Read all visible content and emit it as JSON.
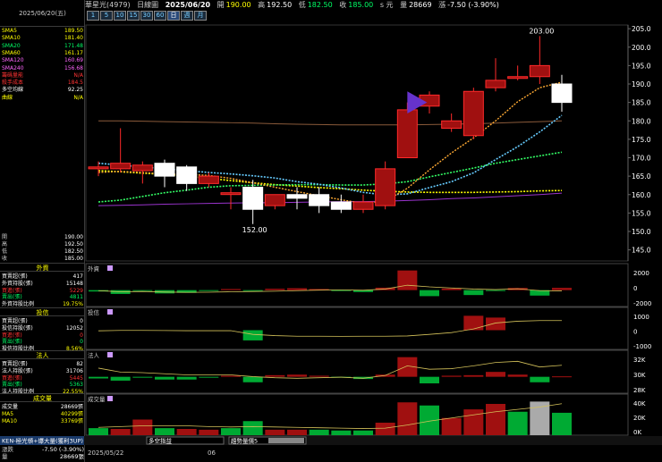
{
  "left": {
    "date": "2025/06/20(五)",
    "ma": [
      {
        "k": "SMA5",
        "v": "189.50",
        "c": "#ffff00"
      },
      {
        "k": "SMA10",
        "v": "181.40",
        "c": "#ffff00"
      },
      {
        "k": "SMA20",
        "v": "171.48",
        "c": "#00ff66"
      },
      {
        "k": "SMA60",
        "v": "161.17",
        "c": "#ffff00"
      },
      {
        "k": "SMA120",
        "v": "160.69",
        "c": "#ff66ff"
      },
      {
        "k": "SMA240",
        "v": "156.68",
        "c": "#ff66ff"
      },
      {
        "k": "籌碼量能",
        "v": "N/A",
        "c": "#ff3333"
      },
      {
        "k": "殺手成本",
        "v": "184.5",
        "c": "#ff3333"
      },
      {
        "k": "多空均線",
        "v": "92.25",
        "c": "#ffffff"
      },
      {
        "k": "曲線",
        "v": "N/A",
        "c": "#ffff00"
      }
    ],
    "ohlc": [
      {
        "k": "開",
        "v": "190.00"
      },
      {
        "k": "高",
        "v": "192.50"
      },
      {
        "k": "低",
        "v": "182.50"
      },
      {
        "k": "收",
        "v": "185.00"
      }
    ],
    "sections": [
      {
        "title": "外資",
        "top": 294,
        "rows": [
          {
            "k": "買賣超(張)",
            "v": "417",
            "kc": "#fff",
            "vc": "#fff"
          },
          {
            "k": "外資持股(張)",
            "v": "15148",
            "kc": "#fff",
            "vc": "#fff"
          },
          {
            "k": "買進(張)",
            "v": "5229",
            "kc": "#ff3333",
            "vc": "#ff3333"
          },
          {
            "k": "賣出(張)",
            "v": "4811",
            "kc": "#00ff66",
            "vc": "#00ff66"
          },
          {
            "k": "外資持股比例",
            "v": "19.75%",
            "kc": "#fff",
            "vc": "#ffff00"
          }
        ]
      },
      {
        "title": "投信",
        "top": 344,
        "rows": [
          {
            "k": "買賣超(張)",
            "v": "0",
            "kc": "#fff",
            "vc": "#fff"
          },
          {
            "k": "投信持股(張)",
            "v": "12052",
            "kc": "#fff",
            "vc": "#fff"
          },
          {
            "k": "買進(張)",
            "v": "0",
            "kc": "#ff3333",
            "vc": "#ff3333"
          },
          {
            "k": "賣出(張)",
            "v": "0",
            "kc": "#00ff66",
            "vc": "#00ff66"
          },
          {
            "k": "投信持股比例",
            "v": "8.56%",
            "kc": "#fff",
            "vc": "#ffff00"
          }
        ]
      },
      {
        "title": "法人",
        "top": 392,
        "rows": [
          {
            "k": "買賣超(張)",
            "v": "82",
            "kc": "#fff",
            "vc": "#fff"
          },
          {
            "k": "法人持股(張)",
            "v": "31706",
            "kc": "#fff",
            "vc": "#fff"
          },
          {
            "k": "買進(張)",
            "v": "5445",
            "kc": "#ff3333",
            "vc": "#ff3333"
          },
          {
            "k": "賣出(張)",
            "v": "5363",
            "kc": "#00ff66",
            "vc": "#00ff66"
          },
          {
            "k": "法人持股比例",
            "v": "22.55%",
            "kc": "#fff",
            "vc": "#ffff00"
          }
        ]
      },
      {
        "title": "成交量",
        "top": 440,
        "rows": [
          {
            "k": "成交量",
            "v": "28669張",
            "kc": "#fff",
            "vc": "#fff"
          },
          {
            "k": "MA5",
            "v": "40299張",
            "kc": "#ffff00",
            "vc": "#ffff00"
          },
          {
            "k": "MA10",
            "v": "33769張",
            "kc": "#ffff00",
            "vc": "#ffff00"
          }
        ]
      }
    ]
  },
  "header": {
    "stock": "華星光(4979)",
    "period": "日線圖",
    "date": "2025/06/20",
    "open_label": "開",
    "open": "190.00",
    "high_label": "高",
    "high": "192.50",
    "low_label": "低",
    "low": "182.50",
    "close_label": "收",
    "close": "185.00",
    "suffix": "s 元",
    "vol_label": "量",
    "vol": "28669",
    "chg_label": "漲",
    "change": "-7.50 (-3.90%)"
  },
  "periods": [
    "1",
    "5",
    "10",
    "15",
    "30",
    "60",
    "日",
    "週",
    "月"
  ],
  "selected_period": "日",
  "chart_data": {
    "type": "candlestick",
    "y_ticks": [
      "205.0",
      "200.0",
      "195.0",
      "190.0",
      "185.0",
      "180.0",
      "175.0",
      "170.0",
      "165.0",
      "160.0",
      "155.0",
      "150.0",
      "145.0"
    ],
    "annotations": {
      "max": "203.00",
      "min": "152.00"
    },
    "candles": [
      {
        "o": 167,
        "h": 169,
        "l": 165,
        "c": 167.5
      },
      {
        "o": 167,
        "h": 178,
        "l": 166,
        "c": 168.5
      },
      {
        "o": 166.5,
        "h": 169,
        "l": 163,
        "c": 168
      },
      {
        "o": 168.5,
        "h": 169.5,
        "l": 162,
        "c": 165
      },
      {
        "o": 167.5,
        "h": 168,
        "l": 161,
        "c": 163
      },
      {
        "o": 163,
        "h": 166,
        "l": 162,
        "c": 165
      },
      {
        "o": 160.5,
        "h": 162,
        "l": 156,
        "c": 160.5
      },
      {
        "o": 162,
        "h": 164,
        "l": 152,
        "c": 156
      },
      {
        "o": 157,
        "h": 160,
        "l": 156,
        "c": 160
      },
      {
        "o": 160,
        "h": 162,
        "l": 156,
        "c": 159
      },
      {
        "o": 160,
        "h": 162,
        "l": 155,
        "c": 157
      },
      {
        "o": 158,
        "h": 160,
        "l": 155,
        "c": 156
      },
      {
        "o": 156,
        "h": 160,
        "l": 155,
        "c": 158
      },
      {
        "o": 157,
        "h": 169,
        "l": 156,
        "c": 167
      },
      {
        "o": 170,
        "h": 185,
        "l": 170,
        "c": 183
      },
      {
        "o": 184,
        "h": 188,
        "l": 182,
        "c": 187
      },
      {
        "o": 178,
        "h": 182,
        "l": 177,
        "c": 180
      },
      {
        "o": 176,
        "h": 189,
        "l": 175,
        "c": 188
      },
      {
        "o": 189,
        "h": 197,
        "l": 188,
        "c": 191
      },
      {
        "o": 192,
        "h": 195,
        "l": 191,
        "c": 192
      },
      {
        "o": 192,
        "h": 203,
        "l": 190,
        "c": 195
      },
      {
        "o": 190,
        "h": 192.5,
        "l": 182.5,
        "c": 185
      }
    ],
    "ma5": [
      166,
      166.3,
      166,
      165.6,
      165.5,
      165.2,
      164.4,
      163.2,
      162,
      160.8,
      159.7,
      158.6,
      157.6,
      158.2,
      161.7,
      166.7,
      171.3,
      175.4,
      180,
      185.2,
      189,
      190.5
    ],
    "ma10": [
      168.5,
      168,
      167.5,
      167,
      166.5,
      166,
      165.6,
      165.1,
      164.5,
      163.5,
      162.8,
      161.8,
      160.6,
      159.9,
      160.2,
      161.9,
      163.5,
      165.9,
      169.5,
      173,
      177,
      181.5
    ],
    "ma20": [
      158,
      158.5,
      159.5,
      160.5,
      161.2,
      162,
      162.4,
      162.5,
      162.6,
      162.7,
      162.7,
      162.6,
      162.6,
      162.9,
      163.5,
      164.8,
      166,
      167.2,
      168.5,
      169.5,
      170.5,
      171.5
    ],
    "ma60": [
      166.5,
      166.2,
      165.8,
      165.5,
      165,
      164.4,
      163.8,
      163.2,
      162.7,
      162.3,
      161.9,
      161.6,
      161.2,
      160.9,
      160.7,
      160.6,
      160.6,
      160.6,
      160.7,
      160.8,
      161,
      161.1
    ],
    "ma120": [
      157,
      157.1,
      157.2,
      157.4,
      157.5,
      157.6,
      157.7,
      157.8,
      157.8,
      157.9,
      158,
      158.1,
      158.1,
      158.2,
      158.4,
      158.6,
      158.9,
      159.1,
      159.4,
      159.7,
      160,
      160.4
    ],
    "ma240": [
      180,
      180,
      179.9,
      179.8,
      179.7,
      179.6,
      179.5,
      179.4,
      179.2,
      179.1,
      179,
      178.9,
      178.9,
      178.9,
      178.9,
      179,
      179.1,
      179.2,
      179.4,
      179.6,
      179.8,
      180
    ],
    "foreign": {
      "title": "外資",
      "ticks": [
        "2000",
        "0",
        "-2000"
      ],
      "values": [
        -250,
        -700,
        -120,
        -600,
        -500,
        -150,
        200,
        -100,
        250,
        350,
        200,
        -150,
        -350,
        450,
        3600,
        -1100,
        300,
        -900,
        -150,
        400,
        -1000,
        417
      ],
      "line": [
        -100,
        -300,
        -250,
        -350,
        -400,
        -380,
        -300,
        -250,
        -200,
        -100,
        0,
        50,
        -20,
        200,
        900,
        600,
        400,
        200,
        100,
        250,
        -100,
        -150
      ]
    },
    "trust": {
      "title": "投信",
      "ticks": [
        "1000",
        "0",
        "-1000"
      ],
      "values": [
        0,
        0,
        0,
        0,
        0,
        0,
        0,
        -850,
        0,
        0,
        0,
        0,
        0,
        0,
        0,
        0,
        0,
        1200,
        1050,
        0,
        0,
        0
      ],
      "line": [
        -50,
        -20,
        -20,
        -30,
        -40,
        -40,
        -40,
        -350,
        -450,
        -500,
        -500,
        -510,
        -500,
        -500,
        -480,
        -350,
        -200,
        100,
        600,
        750,
        800,
        800
      ]
    },
    "inst": {
      "title": "法人",
      "ticks": [
        "32K",
        "30K",
        "28K"
      ],
      "values": [
        -300,
        -700,
        -100,
        -500,
        -500,
        -150,
        200,
        -1000,
        300,
        400,
        200,
        -150,
        -400,
        400,
        3600,
        -1200,
        200,
        300,
        900,
        400,
        -1000,
        82
      ],
      "line": [
        30.8,
        30.1,
        30,
        29.8,
        29.6,
        29.6,
        29.6,
        29.3,
        29.1,
        29.0,
        29.1,
        29.2,
        29.0,
        29.5,
        31.2,
        30.6,
        30.7,
        31.2,
        31.8,
        32.0,
        31.0,
        31.3
      ]
    },
    "volume": {
      "title": "成交量",
      "ticks": [
        "40K",
        "20K",
        "0K"
      ],
      "values": [
        9000,
        8000,
        20000,
        9000,
        8000,
        7000,
        9000,
        18000,
        7000,
        7000,
        7000,
        6000,
        6000,
        16000,
        42000,
        38000,
        22000,
        33000,
        40000,
        30000,
        43000,
        28669
      ],
      "colors": [
        "g",
        "r",
        "r",
        "g",
        "r",
        "r",
        "g",
        "g",
        "r",
        "r",
        "g",
        "g",
        "g",
        "r",
        "r",
        "g",
        "r",
        "r",
        "r",
        "g",
        "w",
        "g"
      ],
      "ma": [
        10000,
        11000,
        12000,
        12000,
        12000,
        11000,
        10500,
        11000,
        10500,
        10000,
        9500,
        9000,
        8500,
        9000,
        13000,
        18000,
        22000,
        26000,
        30000,
        33000,
        36000,
        40299
      ]
    },
    "sub_labels": {
      "foreign": "外資",
      "trust": "投信",
      "inst": "法人",
      "volume": "成交量"
    }
  },
  "bottom": {
    "row1": [
      "KEN-極光頓+爆大量(獲利3UP)",
      "多空指益",
      "趨勢量價5"
    ],
    "row2_left": "漲跌",
    "row2_lv": "-7.50 (-3.90%)",
    "row3_left": "量",
    "row3_lv": "28669張",
    "date_start": "2025/05/22",
    "date_mid": "06"
  }
}
